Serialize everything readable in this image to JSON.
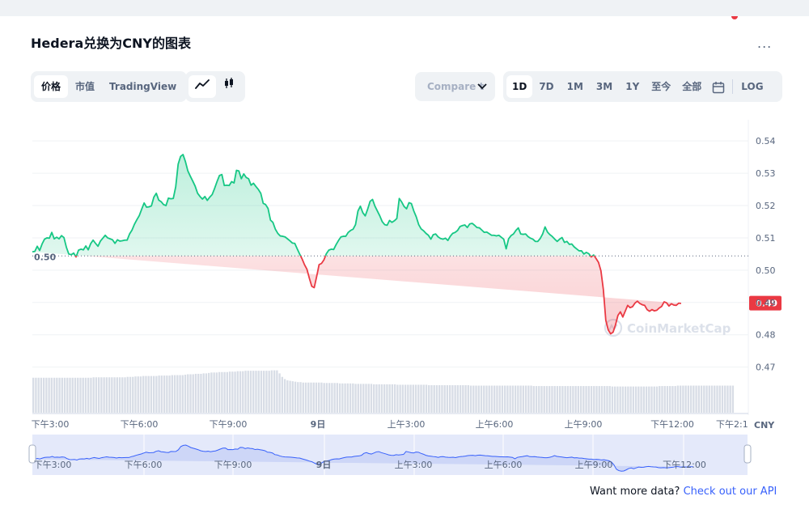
{
  "title": "Hedera兑换为CNY的图表",
  "more_label": "...",
  "view_tabs": [
    "价格",
    "市值",
    "TradingView"
  ],
  "compare_placeholder": "Compare t",
  "ranges": [
    "1D",
    "7D",
    "1M",
    "3M",
    "1Y",
    "至今",
    "全部"
  ],
  "log_label": "LOG",
  "reference_label": "0.50",
  "current_price_label": "0.49",
  "currency_label": "CNY",
  "watermark": "CoinMarketCap",
  "footer_text": "Want more data?",
  "footer_link": "Check out our API",
  "colors": {
    "up": "#16c784",
    "down": "#ea3943",
    "accent": "#3861fb"
  },
  "chart_data": {
    "type": "line",
    "x_ticks": [
      "下午3:00",
      "下午6:00",
      "下午9:00",
      "9日",
      "上午3:00",
      "上午6:00",
      "上午9:00",
      "下午12:00",
      "下午2:1"
    ],
    "nav_ticks": [
      "下午3:00",
      "下午6:00",
      "下午9:00",
      "9日",
      "上午3:00",
      "上午6:00",
      "上午9:00",
      "下午12:00"
    ],
    "y_ticks": [
      "0.54",
      "0.53",
      "0.52",
      "0.51",
      "0.50",
      "0.49",
      "0.48",
      "0.47"
    ],
    "ylim": [
      0.4634,
      0.5443
    ],
    "reference": 0.5044,
    "current": 0.4898,
    "x": [
      0,
      3,
      6,
      9,
      12,
      15,
      18,
      21,
      24,
      27,
      30,
      33,
      36,
      39,
      42,
      45,
      48,
      51,
      54,
      57,
      60,
      63,
      66,
      69,
      72,
      75,
      78,
      81,
      84,
      87,
      90,
      93,
      96,
      99,
      102,
      105,
      108,
      111,
      114,
      117,
      120,
      123,
      126,
      129,
      132,
      135,
      138,
      141,
      144,
      147,
      150,
      153,
      156,
      159,
      162,
      165,
      168,
      171,
      174,
      177,
      180,
      183,
      186,
      189,
      192,
      195,
      198,
      201,
      204,
      207,
      210,
      213,
      216,
      219,
      222,
      225,
      228,
      231,
      234,
      237,
      240,
      243,
      246,
      249,
      252,
      255,
      258,
      261,
      264,
      267,
      270,
      273,
      276,
      279,
      282,
      285,
      288,
      291,
      294,
      297,
      300,
      303,
      306,
      309,
      312,
      315,
      318,
      321,
      324,
      327,
      330,
      333,
      336,
      339,
      342,
      345,
      348,
      351,
      354,
      357,
      360,
      363,
      366,
      369,
      372,
      375,
      378,
      381,
      384,
      387,
      390,
      393,
      396,
      399,
      402,
      405,
      408,
      411,
      414,
      417,
      420,
      423,
      426,
      429,
      432,
      435,
      438,
      441,
      444,
      447,
      450,
      453,
      456,
      459,
      462,
      465,
      468,
      471,
      474,
      477,
      480,
      483,
      486,
      489,
      492,
      495,
      498,
      501,
      504,
      507,
      510,
      513,
      516,
      519,
      522,
      525,
      528,
      531,
      534,
      537,
      540,
      543,
      546,
      549,
      552,
      555,
      558,
      561,
      564,
      567,
      570,
      573,
      576,
      579,
      582,
      585,
      588,
      591,
      594,
      597,
      600,
      603,
      606,
      609,
      612,
      615,
      618,
      621,
      624,
      627,
      630,
      633,
      636,
      639,
      642,
      645,
      648,
      651,
      654,
      657,
      660,
      663,
      666,
      669,
      672,
      675,
      678,
      681,
      684,
      687,
      690,
      693,
      696,
      699,
      702,
      705,
      708,
      711,
      714,
      717,
      720,
      723,
      726,
      729,
      732,
      735,
      738,
      741,
      744,
      747,
      750,
      753,
      756,
      759,
      762,
      765,
      768,
      771,
      774,
      777,
      780,
      783,
      786,
      789,
      792,
      795,
      798,
      801,
      804,
      807,
      810,
      813,
      816,
      819,
      822,
      825,
      828,
      831,
      834,
      837,
      840,
      843,
      846,
      849,
      852,
      855,
      858,
      861,
      864,
      867
    ],
    "values": [
      0.5057,
      0.5058,
      0.5074,
      0.5061,
      0.5081,
      0.5096,
      0.51,
      0.5099,
      0.5117,
      0.5097,
      0.5102,
      0.5097,
      0.5107,
      0.5101,
      0.5071,
      0.505,
      0.5048,
      0.5053,
      0.5041,
      0.5062,
      0.5065,
      0.5063,
      0.5075,
      0.5063,
      0.5082,
      0.5093,
      0.5083,
      0.5074,
      0.509,
      0.5099,
      0.5108,
      0.51,
      0.5097,
      0.5094,
      0.5083,
      0.5094,
      0.509,
      0.5091,
      0.5093,
      0.5093,
      0.5112,
      0.5124,
      0.5142,
      0.5156,
      0.5169,
      0.5189,
      0.5208,
      0.5195,
      0.5196,
      0.5199,
      0.5226,
      0.5238,
      0.5217,
      0.5212,
      0.5203,
      0.52,
      0.5223,
      0.5221,
      0.5222,
      0.5258,
      0.5328,
      0.5352,
      0.5358,
      0.5336,
      0.5307,
      0.5291,
      0.5276,
      0.526,
      0.5238,
      0.5228,
      0.522,
      0.5228,
      0.5216,
      0.5226,
      0.5234,
      0.5253,
      0.5274,
      0.5293,
      0.5296,
      0.5262,
      0.5263,
      0.5262,
      0.5274,
      0.527,
      0.5309,
      0.5307,
      0.5283,
      0.5298,
      0.5287,
      0.5283,
      0.5263,
      0.5269,
      0.5259,
      0.525,
      0.5238,
      0.5207,
      0.5203,
      0.5191,
      0.5155,
      0.5148,
      0.5127,
      0.5114,
      0.5106,
      0.5105,
      0.5103,
      0.5097,
      0.5091,
      0.5084,
      0.5083,
      0.5066,
      0.505,
      0.5035,
      0.5017,
      0.5003,
      0.4975,
      0.495,
      0.4946,
      0.498,
      0.5017,
      0.5021,
      0.5032,
      0.5051,
      0.5062,
      0.5065,
      0.5064,
      0.5079,
      0.5092,
      0.5103,
      0.5105,
      0.5105,
      0.5117,
      0.5123,
      0.5127,
      0.5141,
      0.5183,
      0.5198,
      0.5178,
      0.5168,
      0.5189,
      0.5213,
      0.5219,
      0.5198,
      0.5183,
      0.5168,
      0.515,
      0.5141,
      0.5139,
      0.5154,
      0.5148,
      0.5153,
      0.516,
      0.5222,
      0.5211,
      0.5197,
      0.519,
      0.5209,
      0.5206,
      0.5183,
      0.5165,
      0.5141,
      0.5128,
      0.5122,
      0.5114,
      0.5108,
      0.5096,
      0.511,
      0.5112,
      0.5103,
      0.5098,
      0.5096,
      0.5099,
      0.5092,
      0.5105,
      0.5114,
      0.5117,
      0.5123,
      0.5135,
      0.5138,
      0.514,
      0.5132,
      0.5143,
      0.5145,
      0.5139,
      0.5132,
      0.5131,
      0.5124,
      0.5117,
      0.5118,
      0.5113,
      0.5108,
      0.5108,
      0.5106,
      0.5108,
      0.5102,
      0.5096,
      0.5066,
      0.5097,
      0.5107,
      0.5112,
      0.5123,
      0.5131,
      0.5112,
      0.5111,
      0.5112,
      0.5104,
      0.5099,
      0.5096,
      0.5089,
      0.5089,
      0.5098,
      0.5112,
      0.5134,
      0.5118,
      0.511,
      0.5104,
      0.5096,
      0.5089,
      0.5096,
      0.5101,
      0.5086,
      0.5089,
      0.508,
      0.5081,
      0.5072,
      0.5066,
      0.506,
      0.506,
      0.505,
      0.5055,
      0.5051,
      0.5041,
      0.5047,
      0.5036,
      0.5024,
      0.4998,
      0.494,
      0.4845,
      0.4815,
      0.4803,
      0.4808,
      0.4831,
      0.486,
      0.4871,
      0.4855,
      0.4873,
      0.4891,
      0.4884,
      0.4887,
      0.4898,
      0.4904,
      0.4897,
      0.4893,
      0.4891,
      0.4878,
      0.4873,
      0.4878,
      0.4874,
      0.4876,
      0.4883,
      0.4888,
      0.4902,
      0.4899,
      0.4889,
      0.4896,
      0.4892,
      0.4891,
      0.4898,
      0.4897
    ],
    "volume": [
      0.8,
      0.8,
      0.8,
      0.8,
      0.8,
      0.8,
      0.8,
      0.8,
      0.8,
      0.8,
      0.8,
      0.8,
      0.8,
      0.8,
      0.8,
      0.8,
      0.8,
      0.8,
      0.8,
      0.8,
      0.8,
      0.8,
      0.8,
      0.81,
      0.81,
      0.81,
      0.81,
      0.81,
      0.81,
      0.81,
      0.81,
      0.81,
      0.81,
      0.81,
      0.81,
      0.81,
      0.82,
      0.82,
      0.82,
      0.83,
      0.83,
      0.83,
      0.84,
      0.84,
      0.84,
      0.84,
      0.84,
      0.84,
      0.85,
      0.85,
      0.85,
      0.85,
      0.85,
      0.86,
      0.86,
      0.86,
      0.86,
      0.86,
      0.87,
      0.88,
      0.88,
      0.88,
      0.89,
      0.89,
      0.89,
      0.9,
      0.9,
      0.91,
      0.92,
      0.92,
      0.92,
      0.93,
      0.93,
      0.93,
      0.93,
      0.94,
      0.94,
      0.94,
      0.95,
      0.95,
      0.95,
      0.96,
      0.96,
      0.96,
      0.96,
      0.96,
      0.96,
      0.96,
      0.96,
      0.96,
      0.96,
      0.97,
      0.97,
      0.97,
      0.9,
      0.82,
      0.77,
      0.74,
      0.73,
      0.72,
      0.71,
      0.7,
      0.7,
      0.69,
      0.69,
      0.69,
      0.69,
      0.69,
      0.69,
      0.69,
      0.69,
      0.68,
      0.68,
      0.68,
      0.68,
      0.68,
      0.68,
      0.67,
      0.67,
      0.67,
      0.67,
      0.67,
      0.67,
      0.66,
      0.66,
      0.66,
      0.66,
      0.66,
      0.66,
      0.66,
      0.65,
      0.65,
      0.65,
      0.65,
      0.65,
      0.65,
      0.65,
      0.65,
      0.65,
      0.64,
      0.64,
      0.64,
      0.64,
      0.64,
      0.64,
      0.64,
      0.64,
      0.64,
      0.64,
      0.64,
      0.64,
      0.63,
      0.63,
      0.63,
      0.63,
      0.63,
      0.63,
      0.63,
      0.63,
      0.63,
      0.63,
      0.63,
      0.63,
      0.63,
      0.63,
      0.63,
      0.63,
      0.62,
      0.62,
      0.62,
      0.62,
      0.62,
      0.62,
      0.62,
      0.62,
      0.62,
      0.62,
      0.62,
      0.62,
      0.62,
      0.62,
      0.62,
      0.62,
      0.62,
      0.62,
      0.62,
      0.62,
      0.62,
      0.62,
      0.62,
      0.62,
      0.61,
      0.61,
      0.61,
      0.61,
      0.61,
      0.61,
      0.61,
      0.61,
      0.61,
      0.61,
      0.61,
      0.61,
      0.61,
      0.61,
      0.61,
      0.61,
      0.61,
      0.61,
      0.61,
      0.61,
      0.61,
      0.61,
      0.61,
      0.61,
      0.61,
      0.61,
      0.61,
      0.61,
      0.61,
      0.61,
      0.6,
      0.6,
      0.6,
      0.6,
      0.6,
      0.6,
      0.6,
      0.6,
      0.6,
      0.6,
      0.6,
      0.6,
      0.6,
      0.6,
      0.6,
      0.6,
      0.6,
      0.6,
      0.61,
      0.61,
      0.61,
      0.61,
      0.61,
      0.61,
      0.61,
      0.62,
      0.62,
      0.62,
      0.62,
      0.62,
      0.62,
      0.62,
      0.62,
      0.62,
      0.62,
      0.62,
      0.62,
      0.62,
      0.62,
      0.62,
      0.62,
      0.62,
      0.62,
      0.62,
      0.62,
      0.62,
      0.62
    ]
  }
}
